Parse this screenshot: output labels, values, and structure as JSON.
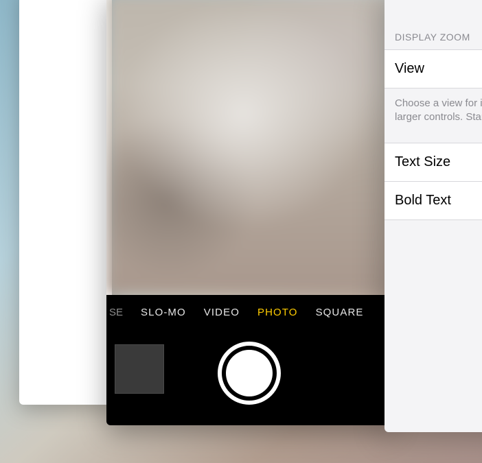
{
  "camera": {
    "modes": {
      "edge_left": "SE",
      "slo_mo": "SLO-MO",
      "video": "VIDEO",
      "photo": "PHOTO",
      "square": "SQUARE"
    }
  },
  "settings": {
    "section_display_zoom": "Display Zoom",
    "row_view": "View",
    "note_view": "Choose a view for iPhone. Zoomed shows larger controls. Standard shows more content.",
    "row_text_size": "Text Size",
    "row_bold_text": "Bold Text"
  }
}
